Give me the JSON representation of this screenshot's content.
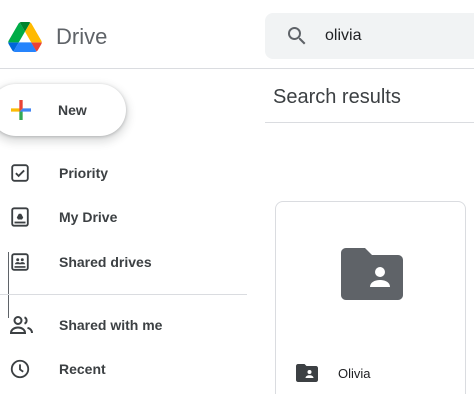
{
  "header": {
    "app_name": "Drive",
    "logo_icon": "google-drive-logo",
    "search": {
      "icon": "search-icon",
      "value": "olivia"
    }
  },
  "sidebar": {
    "new_button": {
      "label": "New",
      "icon": "multicolor-plus-icon"
    },
    "items": [
      {
        "label": "Priority",
        "icon": "checkbox-icon"
      },
      {
        "label": "My Drive",
        "icon": "my-drive-icon"
      },
      {
        "label": "Shared drives",
        "icon": "shared-drives-icon"
      },
      {
        "label": "Shared with me",
        "icon": "people-icon"
      },
      {
        "label": "Recent",
        "icon": "clock-icon"
      }
    ]
  },
  "main": {
    "title": "Search results",
    "results": [
      {
        "name": "Olivia",
        "type": "shared-folder",
        "icon": "shared-folder-icon"
      }
    ]
  },
  "colors": {
    "icon_gray": "#5f6368",
    "folder_gray": "#5f6368",
    "text": "#3c4043",
    "divider": "#dadce0",
    "search_bg": "#f1f3f4",
    "google_blue": "#4285f4",
    "google_red": "#ea4335",
    "google_yellow": "#fbbc04",
    "google_green": "#34a853"
  }
}
